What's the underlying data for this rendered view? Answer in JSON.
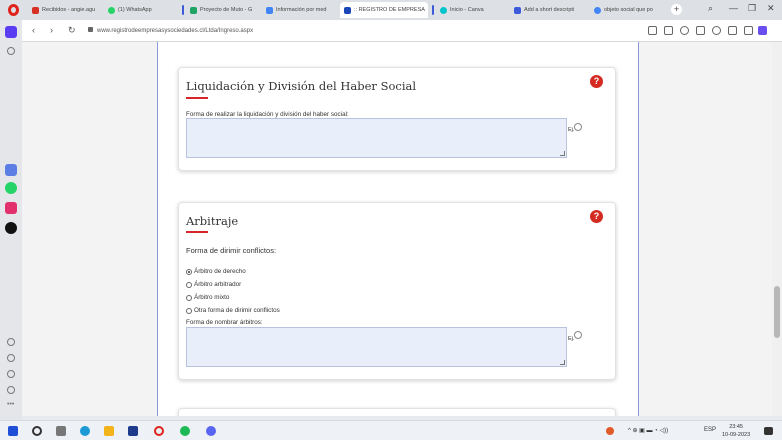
{
  "browser": {
    "tabs": [
      {
        "label": "Recibidos - angie.agu",
        "icon_color": "#d93025",
        "active": false
      },
      {
        "label": "(1) WhatsApp",
        "icon_color": "#25d366",
        "active": false
      },
      {
        "label": "Proyecto de Muto - G",
        "icon_color": "#1fa463",
        "active": false
      },
      {
        "label": "Información por med",
        "icon_color": "#4285f4",
        "active": false
      },
      {
        "label": ":: REGISTRO DE EMPRESA",
        "icon_color": "#1a47b8",
        "active": true
      },
      {
        "label": "Inicio - Canva",
        "icon_color": "#00c4cc",
        "active": false
      },
      {
        "label": "Add a short descripti",
        "icon_color": "#3b5bdb",
        "active": false
      },
      {
        "label": "objeto social que po",
        "icon_color": "#4285f4",
        "active": false
      }
    ],
    "new_tab_glyph": "+",
    "url": "www.registrodeempresasysociedades.cl/Ltda/Ingreso.aspx",
    "nav": {
      "back": "‹",
      "forward": "›",
      "reload": "↻"
    },
    "window_controls": {
      "search": "⌕",
      "minimize": "—",
      "restore": "❐",
      "close": "✕"
    }
  },
  "sections": {
    "liquidacion": {
      "title": "Liquidación y División del Haber Social",
      "help": "?",
      "field_label": "Forma de realizar la liquidación y división del haber social:",
      "field_value": "",
      "example_label": "Ej."
    },
    "arbitraje": {
      "title": "Arbitraje",
      "help": "?",
      "subtitle": "Forma de dirimir conflictos:",
      "options": [
        {
          "label": "Árbitro de derecho",
          "checked": true
        },
        {
          "label": "Árbitro arbitrador",
          "checked": false
        },
        {
          "label": "Árbitro mixto",
          "checked": false
        },
        {
          "label": "Otra forma de dirimir conflictos",
          "checked": false
        }
      ],
      "field_label": "Forma de nombrar árbitros:",
      "field_value": "",
      "example_label": "Ej."
    }
  },
  "taskbar": {
    "tray_text": "ESP",
    "time": "23:45",
    "date": "10-09-2023"
  },
  "colors": {
    "accent_red": "#d7262b",
    "help_red": "#d42a22",
    "field_bg": "#e9eefb",
    "frame_border": "#8a9ad8"
  }
}
